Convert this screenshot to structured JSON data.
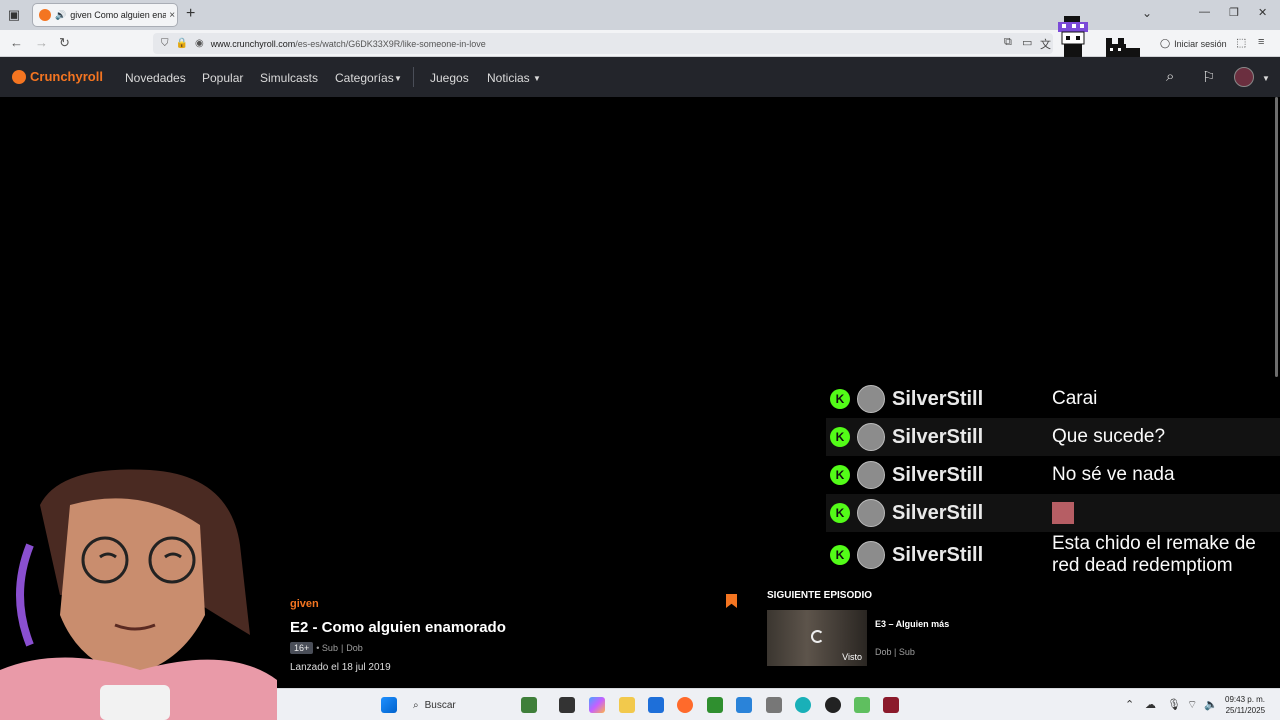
{
  "browser": {
    "tab_title": "given Como alguien enamorado",
    "url_domain": "www.crunchyroll.com",
    "url_path": "/es-es/watch/G6DK33X9R/like-someone-in-love",
    "signin": "Iniciar sesión",
    "new_tab": "+",
    "close_glyph": "×"
  },
  "crunchyroll": {
    "logo": "Crunchyroll",
    "nav": [
      "Novedades",
      "Popular",
      "Simulcasts",
      "Categorías",
      "Juegos",
      "Noticias"
    ],
    "accent": "#f47521"
  },
  "chat": {
    "messages": [
      {
        "user": "SilverStill",
        "text": "Carai"
      },
      {
        "user": "SilverStill",
        "text": "Que sucede?"
      },
      {
        "user": "SilverStill",
        "text": "No sé ve nada"
      },
      {
        "user": "SilverStill",
        "text": "",
        "emote": true
      },
      {
        "user": "SilverStill",
        "text": "Esta chido el remake de red dead redemptiom"
      }
    ],
    "kick_glyph": "K"
  },
  "episode": {
    "series": "given",
    "title": "E2 - Como alguien enamorado",
    "rating": "16+",
    "langs_1": "• Sub",
    "langs_sep": "|",
    "langs_2": "Dob",
    "released": "Lanzado el 18 jul 2019"
  },
  "next": {
    "heading": "SIGUIENTE EPISODIO",
    "title": "E3 – Alguien más",
    "meta": "Dob | Sub",
    "watched": "Visto"
  },
  "taskbar": {
    "search_placeholder": "Buscar",
    "time": "09:43 p. m.",
    "date": "25/11/2025"
  }
}
